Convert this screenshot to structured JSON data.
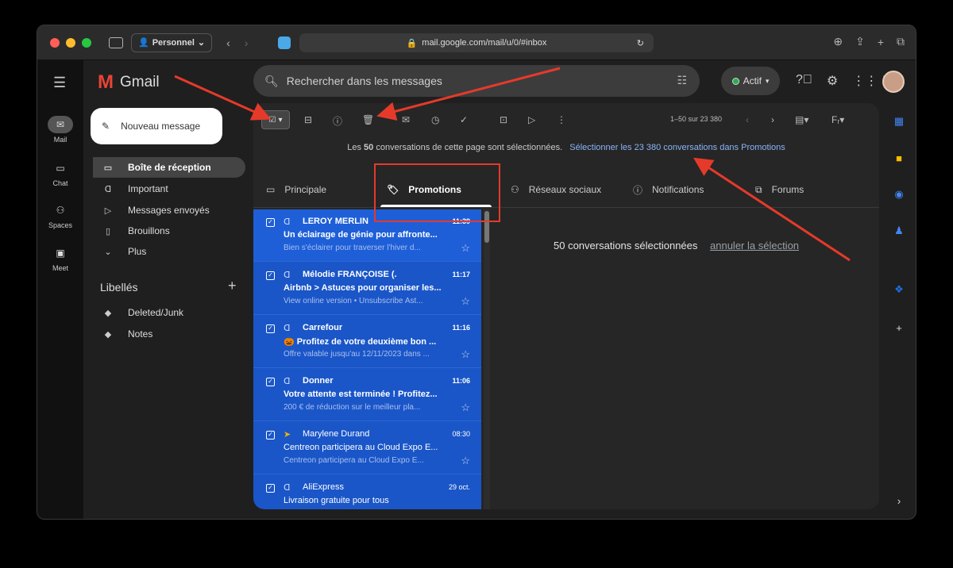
{
  "browser": {
    "profile": "Personnel",
    "url": "mail.google.com/mail/u/0/#inbox"
  },
  "rail": [
    {
      "label": "Mail",
      "icon": "mail-icon"
    },
    {
      "label": "Chat",
      "icon": "chat-icon"
    },
    {
      "label": "Spaces",
      "icon": "spaces-icon"
    },
    {
      "label": "Meet",
      "icon": "meet-icon"
    }
  ],
  "header": {
    "app_name": "Gmail",
    "search_placeholder": "Rechercher dans les messages",
    "status": "Actif"
  },
  "nav": {
    "compose": "Nouveau message",
    "items": [
      {
        "label": "Boîte de réception",
        "icon": "inbox-icon"
      },
      {
        "label": "Important",
        "icon": "important-icon"
      },
      {
        "label": "Messages envoyés",
        "icon": "send-icon"
      },
      {
        "label": "Brouillons",
        "icon": "draft-icon"
      },
      {
        "label": "Plus",
        "icon": "chevron-down-icon"
      }
    ],
    "labels_title": "Libellés",
    "labels": [
      "Deleted/Junk",
      "Notes"
    ]
  },
  "toolbar": {
    "pager": "1–50 sur 23 380"
  },
  "banner": {
    "text_before": "Les",
    "count": "50",
    "text_after": "conversations de cette page sont sélectionnées.",
    "link": "Sélectionner les 23 380 conversations dans Promotions"
  },
  "tabs": [
    "Principale",
    "Promotions",
    "Réseaux sociaux",
    "Notifications",
    "Forums"
  ],
  "emails": [
    {
      "sender": "LEROY MERLIN",
      "time": "11:39",
      "subject": "Un éclairage de génie pour affronte...",
      "snippet": "Bien s'éclairer pour traverser l'hiver d...",
      "bold": true
    },
    {
      "sender": "Mélodie FRANÇOISE (.",
      "time": "11:17",
      "subject": "Airbnb > Astuces pour organiser les...",
      "snippet": "View online version • Unsubscribe Ast...",
      "bold": true
    },
    {
      "sender": "Carrefour",
      "time": "11:16",
      "subject": "🎃 Profitez de votre deuxième bon ...",
      "snippet": "Offre valable jusqu'au 12/11/2023 dans ...",
      "bold": true
    },
    {
      "sender": "Donner",
      "time": "11:06",
      "subject": "Votre attente est terminée ! Profitez...",
      "snippet": "200 € de réduction sur le meilleur pla...",
      "bold": true
    },
    {
      "sender": "Marylene Durand",
      "time": "08:30",
      "subject": "Centreon participera au Cloud Expo E...",
      "snippet": "Centreon participera au Cloud Expo E...",
      "bold": false
    },
    {
      "sender": "AliExpress",
      "time": "29 oct.",
      "subject": "Livraison gratuite pour tous",
      "snippet": "",
      "bold": false
    }
  ],
  "selection": {
    "message": "50 conversations sélectionnées",
    "cancel": "annuler la sélection"
  }
}
